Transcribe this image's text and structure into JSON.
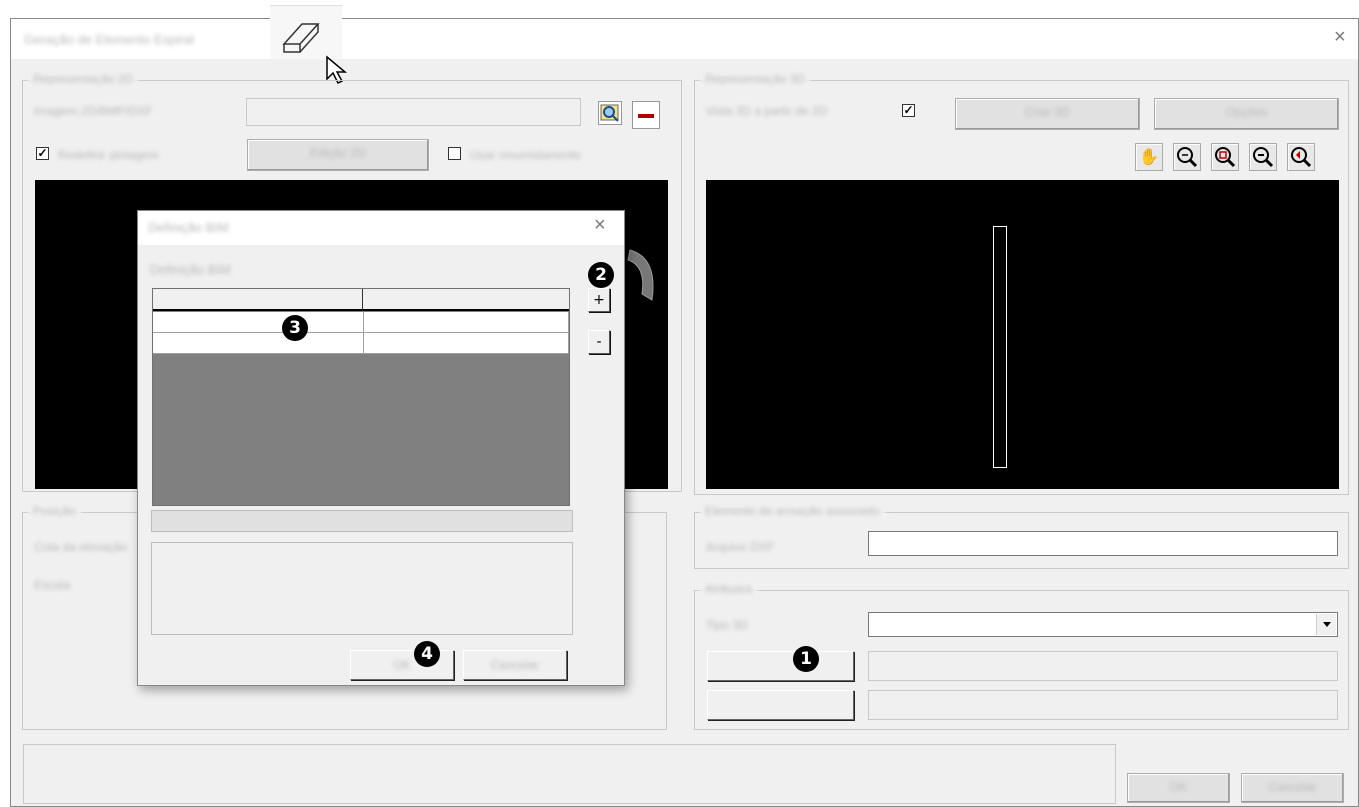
{
  "window": {
    "title": "Geração de Elemento Espiral",
    "close_glyph": "×"
  },
  "left_group": {
    "legend": "Representação 2D",
    "image_label": "Imagem 2D/BMP/DXF",
    "image_value": "",
    "checkbox1_label": "Redefinir plotagem",
    "checkbox1_checked": "✓",
    "center_button": "Edição 2D",
    "checkbox2_label": "Usar resumidamente",
    "checkbox2_checked": ""
  },
  "right_group": {
    "legend": "Representação 3D",
    "label": "Vista 3D a partir de 2D",
    "checkbox_checked": "✓",
    "button1": "Criar 3D",
    "button2": "Opções",
    "toolbar": [
      "hand-icon",
      "zoom-fit-icon",
      "zoom-window-icon",
      "zoom-out-icon",
      "zoom-previous-icon"
    ]
  },
  "bottom_left_group": {
    "legend": "Posição",
    "label1": "Cota da elevação",
    "label2": "Escala"
  },
  "file_group": {
    "legend": "Elemento de armação associado",
    "label": "Arquivo DXF",
    "value": ""
  },
  "attrib_group": {
    "legend": "Atributos",
    "combo_label": "Tipo 3D",
    "combo_value": "",
    "row1_value": "",
    "row2_value": ""
  },
  "footer": {
    "ok": "OK",
    "cancel": "Cancelar"
  },
  "dialog": {
    "title": "Definição BIM",
    "subtitle": "Definição BIM",
    "add_button": "+",
    "remove_button": "-",
    "ok": "OK",
    "cancel": "Cancelar",
    "close_glyph": "×"
  },
  "badges": {
    "b1": "1",
    "b2": "2",
    "b3": "3",
    "b4": "4"
  },
  "colors": {
    "accent_remove": "#b00000",
    "viewport": "#000000",
    "table_empty": "#808080"
  }
}
